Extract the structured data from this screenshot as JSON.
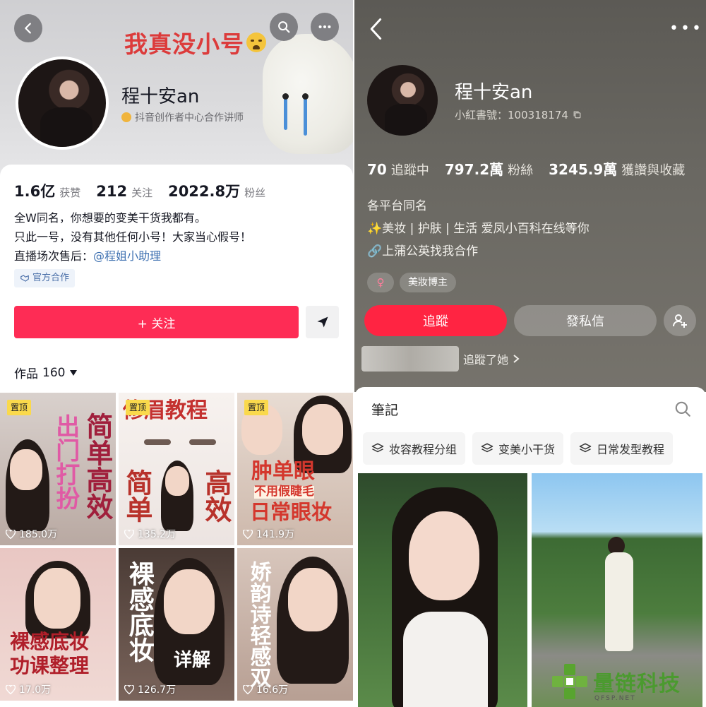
{
  "left": {
    "slogan": "我真没小号",
    "username": "程十安an",
    "verification": "抖音创作者中心合作讲师",
    "stats": [
      {
        "value": "1.6亿",
        "label": "获赞"
      },
      {
        "value": "212",
        "label": "关注"
      },
      {
        "value": "2022.8万",
        "label": "粉丝"
      }
    ],
    "bio_lines": [
      "全W同名，你想要的变美干货我都有。",
      "只此一号，没有其他任何小号！大家当心假号！"
    ],
    "bio_line3_prefix": "直播场次售后：",
    "bio_line3_link": "@程姐小助理",
    "official_tag": "官方合作",
    "follow_label": "+ 关注",
    "works_label": "作品",
    "works_count": "160",
    "pinned_label": "置顶",
    "tiles": [
      {
        "likes": "185.0万",
        "text": [
          "简单高效",
          "出门打扮"
        ],
        "pinned": true
      },
      {
        "likes": "135.2万",
        "text": [
          "修眉教程",
          "简单",
          "高效"
        ],
        "pinned": true
      },
      {
        "likes": "141.9万",
        "text": [
          "肿单眼",
          "不用假睫毛",
          "日常眼妆"
        ],
        "pinned": true
      },
      {
        "likes": "17.0万",
        "text": [
          "裸感底妆",
          "功课整理"
        ],
        "pinned": false
      },
      {
        "likes": "126.7万",
        "text": [
          "裸感底妆",
          "详解"
        ],
        "pinned": false
      },
      {
        "likes": "16.6万",
        "text": [
          "娇韵诗轻感双"
        ],
        "pinned": false
      }
    ]
  },
  "right": {
    "username": "程十安an",
    "account_id": "小紅書號：100318174",
    "stats": [
      {
        "value": "70",
        "label": "追蹤中"
      },
      {
        "value": "797.2萬",
        "label": "粉絲"
      },
      {
        "value": "3245.9萬",
        "label": "獲讚與收藏"
      }
    ],
    "bio_lines": [
      "各平台同名",
      "✨美妆 | 护肤 | 生活 爱凤小百科在线等你",
      "🔗上蒲公英找我合作"
    ],
    "gender_tag": "♀",
    "category_tag": "美妝博主",
    "follow_label": "追蹤",
    "message_label": "發私信",
    "followed_text": "追蹤了她",
    "notes_tab": "筆記",
    "collections": [
      "妆容教程分组",
      "变美小干货",
      "日常发型教程"
    ]
  },
  "watermark": {
    "text": "量链科技",
    "sub": "QFSP.NET"
  },
  "colors": {
    "douyin_red": "#fe2c55",
    "xhs_red": "#ff2442",
    "link_blue": "#3c6fb0"
  }
}
